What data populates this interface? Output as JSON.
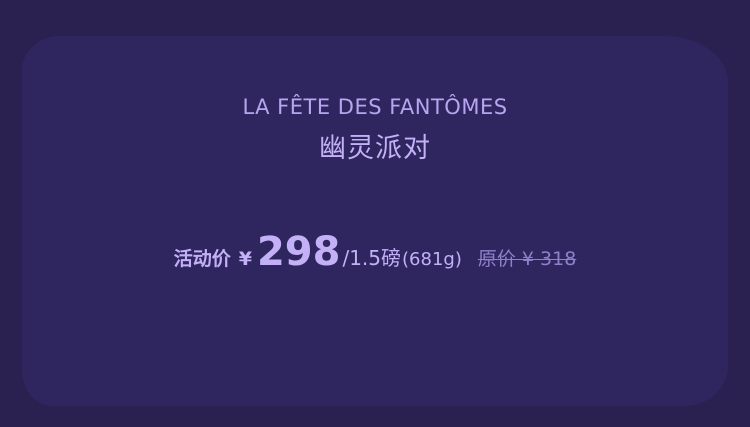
{
  "event": {
    "title_en": "LA FÊTE DES FANTÔMES",
    "title_cn": "幽灵派对"
  },
  "pricing": {
    "promo_label": "活动价",
    "currency_symbol": "¥",
    "price": "298",
    "unit": "/1.5磅",
    "weight": "(681g)",
    "original_price": "原价 ¥ 318"
  },
  "colors": {
    "background": "#2a2150",
    "card": "#2f2660",
    "text": "#c3b0f7",
    "muted": "#8f80c8"
  }
}
